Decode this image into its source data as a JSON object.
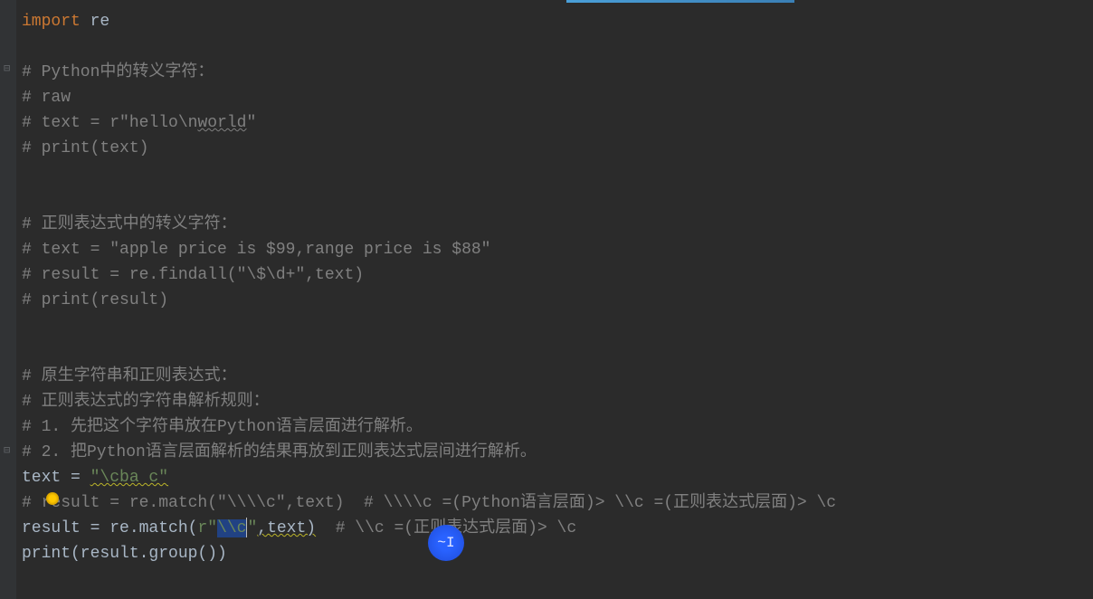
{
  "code": {
    "line1": {
      "import_kw": "import",
      "module": " re"
    },
    "line3_comment": "# Python中的转义字符：",
    "line4_comment": "# raw",
    "line5": {
      "prefix": "# text = r",
      "str_open": "\"",
      "str_body1": "hello",
      "str_escape": "\\n",
      "str_body2": "world",
      "str_close": "\""
    },
    "line6_comment": "# print(text)",
    "line9_comment": "# 正则表达式中的转义字符：",
    "line10_comment": "# text = \"apple price is $99,range price is $88\"",
    "line11_comment": "# result = re.findall(\"\\$\\d+\",text)",
    "line12_comment": "# print(result)",
    "line15_comment": "# 原生字符串和正则表达式：",
    "line16_comment": "# 正则表达式的字符串解析规则：",
    "line17_comment": "# 1. 先把这个字符串放在Python语言层面进行解析。",
    "line18_comment": "# 2. 把Python语言层面解析的结果再放到正则表达式层间进行解析。",
    "line19": {
      "prefix": "text = ",
      "str": "\"\\cba c\""
    },
    "line20_comment": "# result = re.match(\"\\\\\\\\c\",text)  # \\\\\\\\c =(Python语言层面)> \\\\c =(正则表达式层面)> \\c",
    "line21": {
      "p1": "result = re.match(",
      "raw_prefix": "r",
      "str_open": "\"",
      "selected": "\\\\c",
      "str_close": "\"",
      "p2": ",text)",
      "comment": "  # \\\\c =(正则表达式层面)> \\c"
    },
    "line22": "print(result.group())"
  },
  "icons": {
    "cursor_indicator": "~I",
    "fold_down": "⊟"
  }
}
